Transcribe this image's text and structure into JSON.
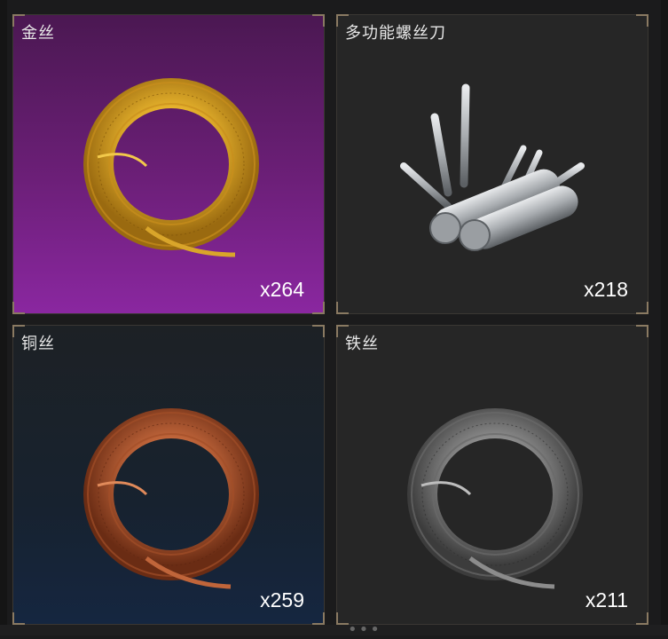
{
  "items": [
    {
      "name": "金丝",
      "quantity": "x264",
      "rarity_color": "#7a2189",
      "icon": "gold-wire-coil"
    },
    {
      "name": "多功能螺丝刀",
      "quantity": "x218",
      "rarity_color": "#262626",
      "icon": "multi-tool-screwdriver"
    },
    {
      "name": "铜丝",
      "quantity": "x259",
      "rarity_color": "#152640",
      "icon": "copper-wire-coil"
    },
    {
      "name": "铁丝",
      "quantity": "x211",
      "rarity_color": "#262626",
      "icon": "iron-wire-coil"
    }
  ],
  "colors": {
    "gold": "#e0a82a",
    "copper": "#c0653a",
    "iron": "#8c8c8c",
    "steel": "#b8bcc0"
  }
}
